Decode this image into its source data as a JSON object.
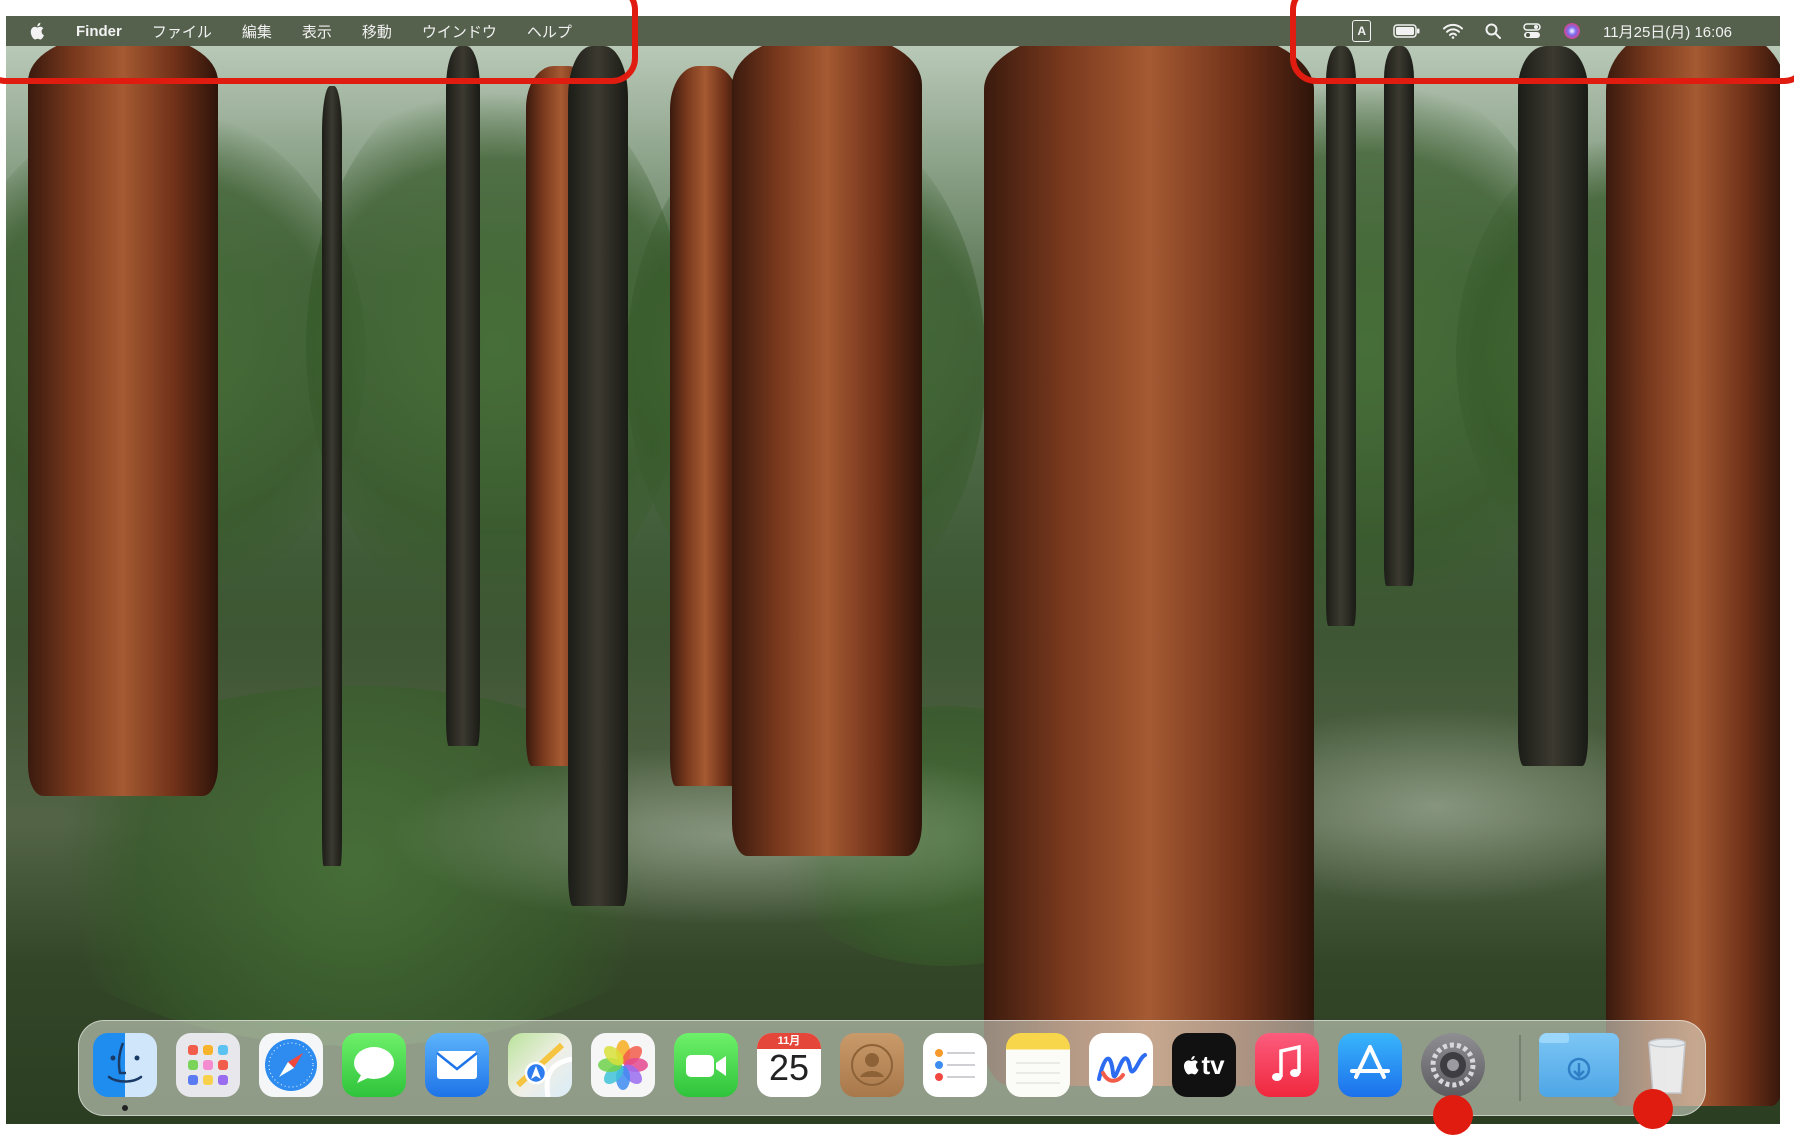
{
  "menubar": {
    "apple_menu_icon": "apple-logo",
    "left_items": [
      "Finder",
      "ファイル",
      "編集",
      "表示",
      "移動",
      "ウインドウ",
      "ヘルプ"
    ],
    "input_method": "A",
    "status_icons": [
      "battery-icon",
      "wifi-icon",
      "spotlight-search-icon",
      "control-center-icon",
      "siri-icon"
    ],
    "datetime": "11月25日(月) 16:06"
  },
  "dock": {
    "apps": [
      {
        "name": "Finder",
        "icon": "finder-icon",
        "running": true
      },
      {
        "name": "Launchpad",
        "icon": "launchpad-icon"
      },
      {
        "name": "Safari",
        "icon": "safari-icon"
      },
      {
        "name": "Messages",
        "icon": "messages-icon"
      },
      {
        "name": "Mail",
        "icon": "mail-icon"
      },
      {
        "name": "Maps",
        "icon": "maps-icon"
      },
      {
        "name": "Photos",
        "icon": "photos-icon"
      },
      {
        "name": "FaceTime",
        "icon": "facetime-icon"
      },
      {
        "name": "Calendar",
        "icon": "calendar-icon",
        "month_label": "11月",
        "day_label": "25"
      },
      {
        "name": "Contacts",
        "icon": "contacts-icon"
      },
      {
        "name": "Reminders",
        "icon": "reminders-icon"
      },
      {
        "name": "Notes",
        "icon": "notes-icon"
      },
      {
        "name": "Freeform",
        "icon": "freeform-icon"
      },
      {
        "name": "TV",
        "icon": "appletv-icon",
        "label": "tv"
      },
      {
        "name": "Music",
        "icon": "music-icon"
      },
      {
        "name": "App Store",
        "icon": "appstore-icon"
      },
      {
        "name": "System Settings",
        "icon": "system-settings-icon"
      }
    ],
    "stacks": [
      {
        "name": "Downloads",
        "icon": "downloads-folder-icon"
      },
      {
        "name": "Trash",
        "icon": "trash-icon"
      }
    ]
  },
  "annotations": {
    "color": "#e01c10",
    "highlighted": [
      "menubar-left",
      "menubar-right",
      "system-settings",
      "trash"
    ]
  }
}
